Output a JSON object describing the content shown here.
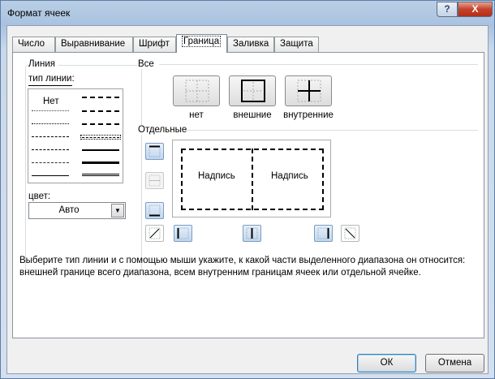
{
  "window": {
    "title": "Формат ячеек",
    "help_glyph": "?",
    "close_glyph": "X"
  },
  "tabs": [
    {
      "label": "Число"
    },
    {
      "label": "Выравнивание"
    },
    {
      "label": "Шрифт"
    },
    {
      "label": "Граница",
      "active": true
    },
    {
      "label": "Заливка"
    },
    {
      "label": "Защита"
    }
  ],
  "line_group": {
    "title": "Линия",
    "type_label": "тип линии:",
    "none_label": "Нет",
    "color_label": "цвет:",
    "color_value": "Авто"
  },
  "presets": {
    "title": "Все",
    "items": [
      {
        "label": "нет",
        "icon": "border-none-icon"
      },
      {
        "label": "внешние",
        "icon": "border-outline-icon"
      },
      {
        "label": "внутренние",
        "icon": "border-inside-icon"
      }
    ]
  },
  "individual": {
    "title": "Отдельные",
    "preview_text_left": "Надпись",
    "preview_text_right": "Надпись"
  },
  "hint": {
    "line1": "Выберите тип линии и с помощью мыши укажите, к какой части выделенного диапазона он относится:",
    "line2": "внешней границе всего диапазона, всем внутренним границам ячеек или отдельной ячейке."
  },
  "buttons": {
    "ok": "ОК",
    "cancel": "Отмена"
  },
  "colors": {
    "accent": "#3c7fb1",
    "border_btn": "#c0d6ef"
  }
}
